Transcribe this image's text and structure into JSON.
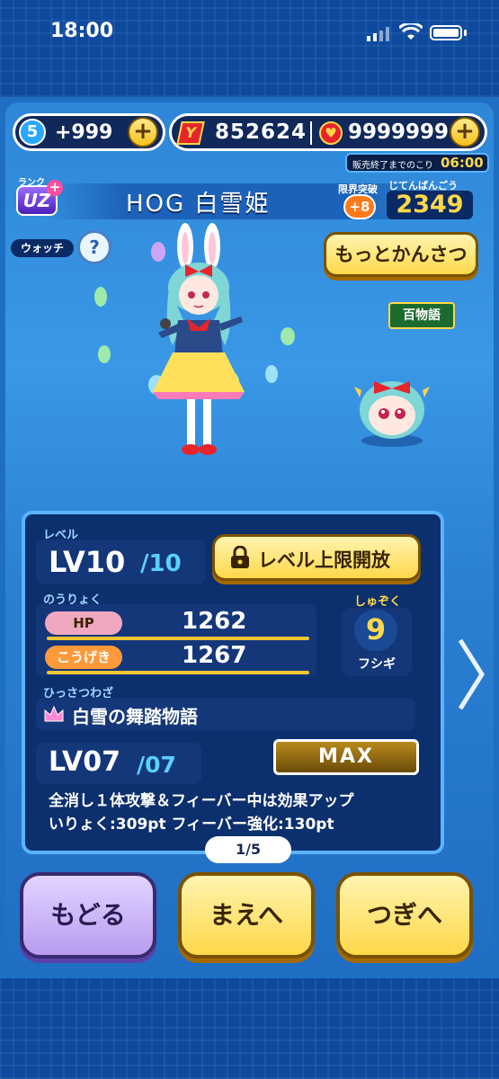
{
  "status_bar": {
    "time": "18:00"
  },
  "currency": {
    "sp_count": "5",
    "sp_value": "+999",
    "money": "852624",
    "gems": "9999999",
    "sale_notice": "販売終了までのこり",
    "sale_time": "06:00"
  },
  "character": {
    "rank_label": "ランク",
    "rank_value": "UZ",
    "rank_plus": "+",
    "name": "HOG 白雪姫",
    "limit_break_label": "限界突破",
    "limit_break_value": "+8",
    "dex_label": "じてんばんごう",
    "dex_number": "2349",
    "watch_label": "ウォッチ",
    "watch_icon": "?",
    "observe_button": "もっとかんさつ",
    "series_badge": "百物語"
  },
  "level": {
    "label": "レベル",
    "current": "LV10",
    "max": "/10",
    "unlock_button": "レベル上限開放"
  },
  "stats": {
    "label": "のうりょく",
    "hp_label": "HP",
    "hp_value": "1262",
    "attack_label": "こうげき",
    "attack_value": "1267"
  },
  "tribe": {
    "label": "しゅぞく",
    "icon": "9",
    "name": "フシギ"
  },
  "skill": {
    "label": "ひっさつわざ",
    "name": "白雪の舞踏物語",
    "level": "LV07",
    "level_max": "/07",
    "max_badge": "MAX",
    "description": "全消し１体攻撃＆フィーバー中は効果アップ",
    "power": "いりょく:309pt フィーバー強化:130pt"
  },
  "pager": {
    "text": "1/5"
  },
  "nav": {
    "back": "もどる",
    "prev": "まえへ",
    "next": "つぎへ"
  },
  "colors": {
    "accent": "#ffd84a",
    "panel": "#0c2f6e",
    "back_button": "#b99cf0"
  }
}
